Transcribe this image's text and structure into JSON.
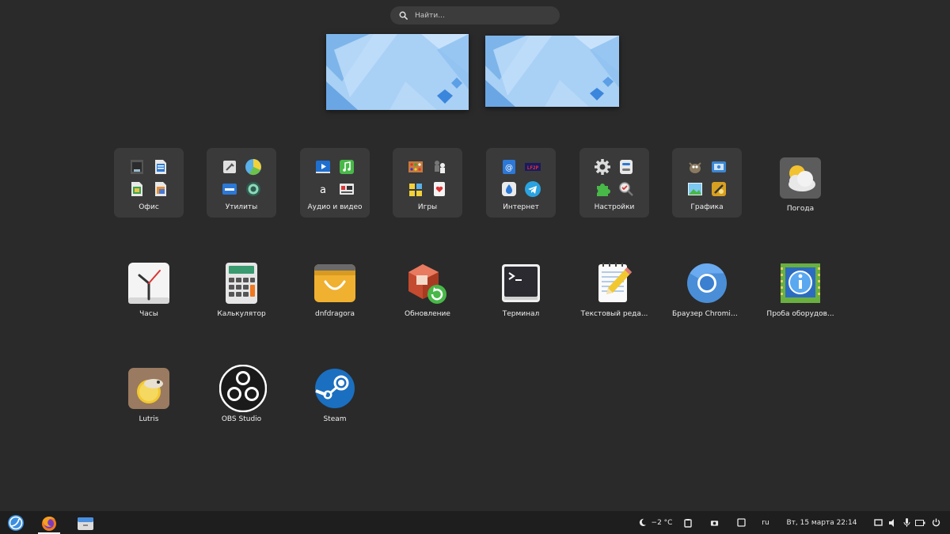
{
  "search": {
    "placeholder": "Найти..."
  },
  "folders": [
    {
      "label": "Офис"
    },
    {
      "label": "Утилиты"
    },
    {
      "label": "Аудио и видео"
    },
    {
      "label": "Игры"
    },
    {
      "label": "Интернет"
    },
    {
      "label": "Настройки"
    },
    {
      "label": "Графика"
    }
  ],
  "apps": [
    {
      "label": "Погода",
      "icon": "weather-icon"
    },
    {
      "label": "Часы",
      "icon": "clock-icon"
    },
    {
      "label": "Калькулятор",
      "icon": "calculator-icon"
    },
    {
      "label": "dnfdragora",
      "icon": "dnfdragora-icon"
    },
    {
      "label": "Обновление",
      "icon": "update-icon"
    },
    {
      "label": "Терминал",
      "icon": "terminal-icon"
    },
    {
      "label": "Текстовый реда...",
      "icon": "text-editor-icon"
    },
    {
      "label": "Браузер Chromiu...",
      "icon": "chromium-icon"
    },
    {
      "label": "Проба оборудов...",
      "icon": "hardware-probe-icon"
    },
    {
      "label": "Lutris",
      "icon": "lutris-icon"
    },
    {
      "label": "OBS Studio",
      "icon": "obs-icon"
    },
    {
      "label": "Steam",
      "icon": "steam-icon"
    }
  ],
  "taskbar": {
    "weather": "−2 °C",
    "language": "ru",
    "datetime": "Вт, 15 марта  22:14"
  },
  "colors": {
    "background": "#2a2a2a",
    "folder_bg": "#3a3a3a",
    "taskbar_bg": "#1e1e1e",
    "wallpaper_blue": "#8ec0ef"
  }
}
